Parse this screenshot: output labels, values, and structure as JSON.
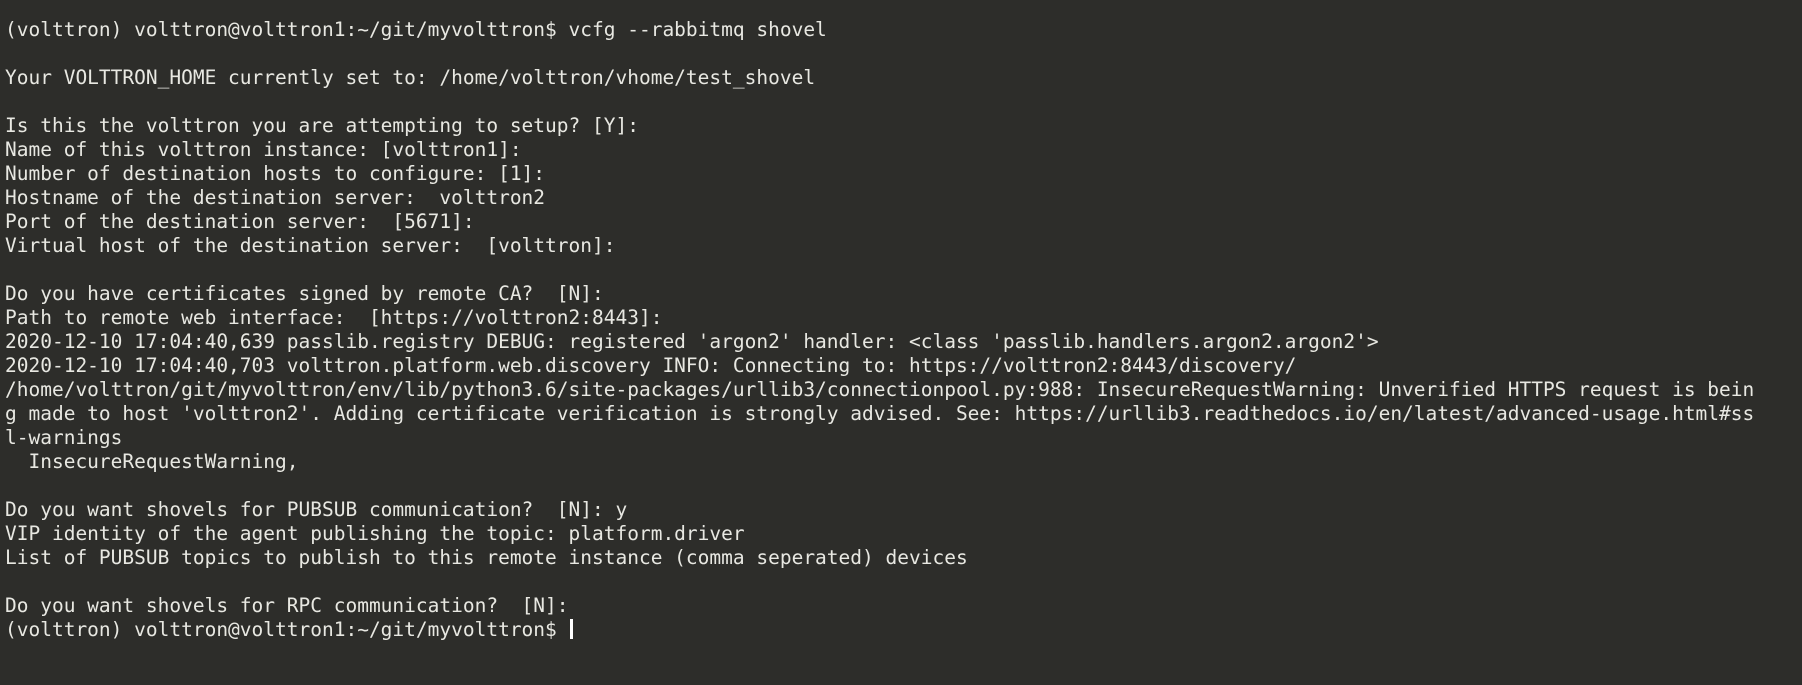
{
  "terminal": {
    "lines": [
      "(volttron) volttron@volttron1:~/git/myvolttron$ vcfg --rabbitmq shovel",
      "",
      "Your VOLTTRON_HOME currently set to: /home/volttron/vhome/test_shovel",
      "",
      "Is this the volttron you are attempting to setup? [Y]:",
      "Name of this volttron instance: [volttron1]:",
      "Number of destination hosts to configure: [1]:",
      "Hostname of the destination server:  volttron2",
      "Port of the destination server:  [5671]:",
      "Virtual host of the destination server:  [volttron]:",
      "",
      "Do you have certificates signed by remote CA?  [N]:",
      "Path to remote web interface:  [https://volttron2:8443]:",
      "2020-12-10 17:04:40,639 passlib.registry DEBUG: registered 'argon2' handler: <class 'passlib.handlers.argon2.argon2'>",
      "2020-12-10 17:04:40,703 volttron.platform.web.discovery INFO: Connecting to: https://volttron2:8443/discovery/",
      "/home/volttron/git/myvolttron/env/lib/python3.6/site-packages/urllib3/connectionpool.py:988: InsecureRequestWarning: Unverified HTTPS request is bein",
      "g made to host 'volttron2'. Adding certificate verification is strongly advised. See: https://urllib3.readthedocs.io/en/latest/advanced-usage.html#ss",
      "l-warnings",
      "  InsecureRequestWarning,",
      "",
      "Do you want shovels for PUBSUB communication?  [N]: y",
      "VIP identity of the agent publishing the topic: platform.driver",
      "List of PUBSUB topics to publish to this remote instance (comma seperated) devices",
      "",
      "Do you want shovels for RPC communication?  [N]:"
    ],
    "prompt": "(volttron) volttron@volttron1:~/git/myvolttron$ "
  }
}
